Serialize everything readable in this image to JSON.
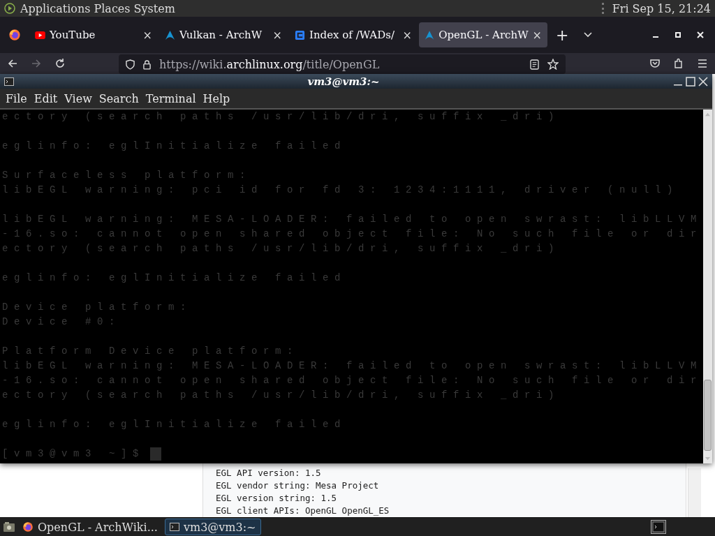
{
  "top_panel": {
    "menus": [
      "Applications",
      "Places",
      "System"
    ],
    "clock": "Fri Sep 15, 21:24"
  },
  "browser": {
    "tabs": [
      {
        "label": "YouTube",
        "kind": "youtube",
        "close": "×",
        "selected": false
      },
      {
        "label": "Vulkan - ArchW",
        "kind": "arch",
        "close": "×",
        "selected": false
      },
      {
        "label": "Index of /WADs/",
        "kind": "index",
        "close": "×",
        "selected": false
      },
      {
        "label": "OpenGL - ArchW",
        "kind": "arch",
        "close": "×",
        "selected": true
      }
    ],
    "new_tab": "+",
    "url": {
      "prefix": "https://wiki.",
      "domain": "archlinux.org",
      "path": "/title/OpenGL"
    },
    "forward_disabled": true,
    "code_lines": [
      "EGL API version: 1.5",
      "EGL vendor string: Mesa Project",
      "EGL version string: 1.5",
      "EGL client APIs: OpenGL OpenGL_ES"
    ]
  },
  "terminal": {
    "title": "vm3@vm3:~",
    "menu": [
      "File",
      "Edit",
      "View",
      "Search",
      "Terminal",
      "Help"
    ],
    "blocks": [
      [
        "ectory (search paths /usr/lib/dri, suffix _dri)"
      ],
      [
        "eglinfo: eglInitialize failed"
      ],
      [
        "Surfaceless platform:",
        "libEGL warning: pci id for fd 3: 1234:1111, driver (null)"
      ],
      [
        "libEGL warning: MESA-LOADER: failed to open swrast: libLLVM",
        "-16.so: cannot open shared object file: No such file or dir",
        "ectory (search paths /usr/lib/dri, suffix _dri)"
      ],
      [
        "eglinfo: eglInitialize failed"
      ],
      [
        "Device platform:",
        "Device #0:"
      ],
      [
        "Platform Device platform:",
        "libEGL warning: MESA-LOADER: failed to open swrast: libLLVM",
        "-16.so: cannot open shared object file: No such file or dir",
        "ectory (search paths /usr/lib/dri, suffix _dri)"
      ],
      [
        "eglinfo: eglInitialize failed"
      ]
    ],
    "prompt": "[vm3@vm3 ~]$"
  },
  "taskbar": {
    "items": [
      {
        "label": "OpenGL - ArchWiki...",
        "kind": "firefox",
        "selected": false
      },
      {
        "label": "vm3@vm3:~",
        "kind": "terminal",
        "selected": true
      }
    ]
  }
}
